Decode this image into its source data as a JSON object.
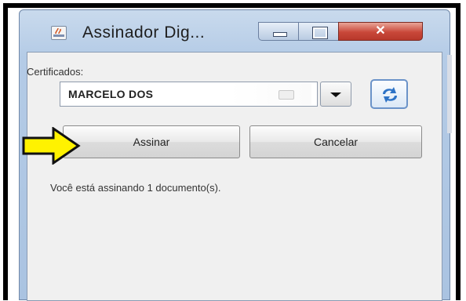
{
  "window": {
    "title": "Assinador Dig...",
    "icons": {
      "app": "java-app-icon",
      "minimize": "minimize-icon",
      "maximize": "maximize-icon",
      "close": "close-icon"
    }
  },
  "form": {
    "certificates_label": "Certificados:",
    "certificate_selected": "MARCELO DOS",
    "refresh_icon": "refresh-icon",
    "sign_label": "Assinar",
    "cancel_label": "Cancelar",
    "status_text": "Você está assinando 1 documento(s)."
  },
  "annotation": {
    "arrow_icon": "arrow-right-icon",
    "arrow_color": "#fff200"
  },
  "colors": {
    "close_button": "#c9483a",
    "titlebar": "#b4cbe6",
    "client_bg": "#f0f0f0"
  }
}
